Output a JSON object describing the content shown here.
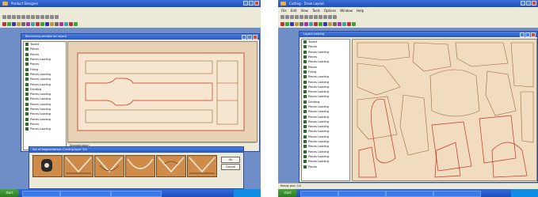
{
  "left": {
    "window_title": "Product Designer",
    "menus": [],
    "doc_title": "Recovering window for layout",
    "tree_items": [
      "Toolkit",
      "Pieces",
      "Pieces",
      "Pieces Loading",
      "Pieces",
      "Filling",
      "Pieces Loading",
      "Pieces Loading",
      "Pieces Loading",
      "Dividing",
      "Pieces Loading",
      "Pieces Loading",
      "Pieces Loading",
      "Pieces Loading",
      "Pieces Loading",
      "Pieces Loading",
      "Pieces",
      "Pieces Loading"
    ],
    "status_text": "Segmentation",
    "dialog_title": "Set of Segmentation: Curving type: 3/4",
    "dialog_buttons": [
      "Ok",
      "Cancel"
    ],
    "taskbar_start": "start",
    "taskbar_tasks": [
      "",
      "",
      ""
    ],
    "tray_time": "",
    "status_left": "Ready pos: 0.0"
  },
  "right": {
    "window_title": "Cutting - Draw Layout",
    "menus": [
      "File",
      "Edit",
      "View",
      "Tools",
      "Options",
      "Window",
      "Help"
    ],
    "doc_title": "Layout nesting",
    "tree_items": [
      "Toolkit",
      "Pieces",
      "Pieces Loading",
      "Pieces",
      "Pieces Loading",
      "Pieces",
      "Filling",
      "Pieces Loading",
      "Pieces Loading",
      "Pieces Loading",
      "Pieces Loading",
      "Pieces Loading",
      "Dividing",
      "Pieces Loading",
      "Pieces Loading",
      "Pieces Loading",
      "Pieces Loading",
      "Pieces Loading",
      "Pieces Loading",
      "Pieces Loading",
      "Pieces Loading",
      "Pieces Loading",
      "Pieces Loading",
      "Pieces Loading",
      "Pieces Loading",
      "Pieces"
    ],
    "status_left": "Ready pos: 0.0",
    "taskbar_start": "start",
    "taskbar_tasks": [
      "",
      "",
      "",
      ""
    ],
    "tray_time": ""
  },
  "colors": {
    "desktop": "#6f8ec8",
    "canvas_fill": "#f1dcc0",
    "cut_line_red": "#c8301e",
    "cut_line_brown": "#9a6a3a",
    "thumb_leather": "#cf8b4a"
  }
}
